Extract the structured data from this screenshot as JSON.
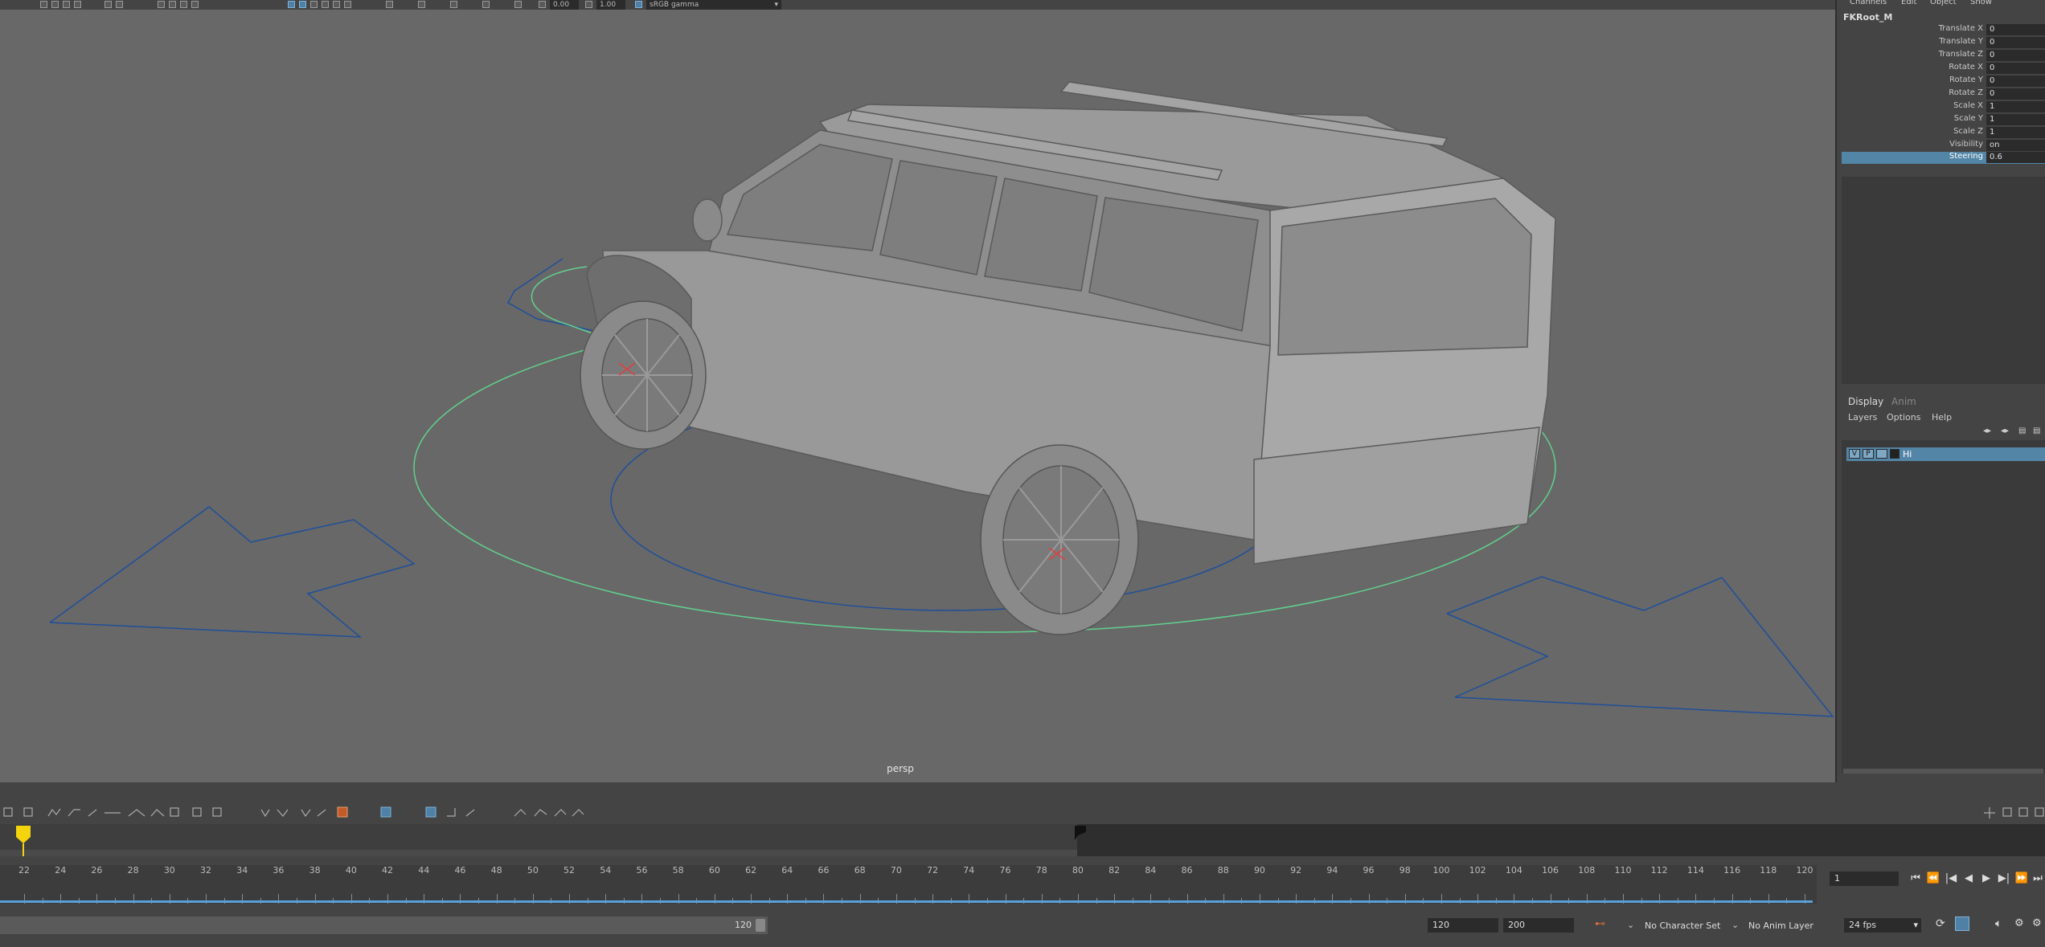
{
  "toolbar": {
    "exposure_value": "0.00",
    "gamma_value": "1.00",
    "color_space": "sRGB gamma"
  },
  "viewport": {
    "camera_label": "persp"
  },
  "channel_box": {
    "menus": [
      "Channels",
      "Edit",
      "Object",
      "Show"
    ],
    "object_name": "FKRoot_M",
    "channels": [
      {
        "label": "Translate X",
        "value": "0"
      },
      {
        "label": "Translate Y",
        "value": "0"
      },
      {
        "label": "Translate Z",
        "value": "0"
      },
      {
        "label": "Rotate X",
        "value": "0"
      },
      {
        "label": "Rotate Y",
        "value": "0"
      },
      {
        "label": "Rotate Z",
        "value": "0"
      },
      {
        "label": "Scale X",
        "value": "1"
      },
      {
        "label": "Scale Y",
        "value": "1"
      },
      {
        "label": "Scale Z",
        "value": "1"
      },
      {
        "label": "Visibility",
        "value": "on"
      },
      {
        "label": "Steering",
        "value": "0.6"
      }
    ]
  },
  "layer_editor": {
    "tabs": [
      "Display",
      "Anim"
    ],
    "menus": [
      "Layers",
      "Options",
      "Help"
    ],
    "layers": [
      {
        "v": "V",
        "p": "P",
        "name": "Hi"
      }
    ]
  },
  "timeline": {
    "current_frame_marker": "22",
    "ruler_labels": [
      "22",
      "24",
      "26",
      "28",
      "30",
      "32",
      "34",
      "36",
      "38",
      "40",
      "42",
      "44",
      "46",
      "48",
      "50",
      "52",
      "54",
      "56",
      "58",
      "60",
      "62",
      "64",
      "66",
      "68",
      "70",
      "72",
      "74",
      "76",
      "78",
      "80",
      "82",
      "84",
      "86",
      "88",
      "90",
      "92",
      "94",
      "96",
      "98",
      "100",
      "102",
      "104",
      "106",
      "108",
      "110",
      "112",
      "114",
      "116",
      "118",
      "120"
    ],
    "current_frame": "1",
    "range_end_display": "120",
    "playback_end": "120",
    "animation_end": "200",
    "character_set": "No Character Set",
    "anim_layer": "No Anim Layer",
    "fps": "24 fps"
  },
  "colors": {
    "viewport_bg": "#686868",
    "selection_blue": "#5285a6",
    "curve_green": "#62d08e",
    "curve_blue": "#1f4f9a",
    "time_marker": "#f4d40c"
  }
}
